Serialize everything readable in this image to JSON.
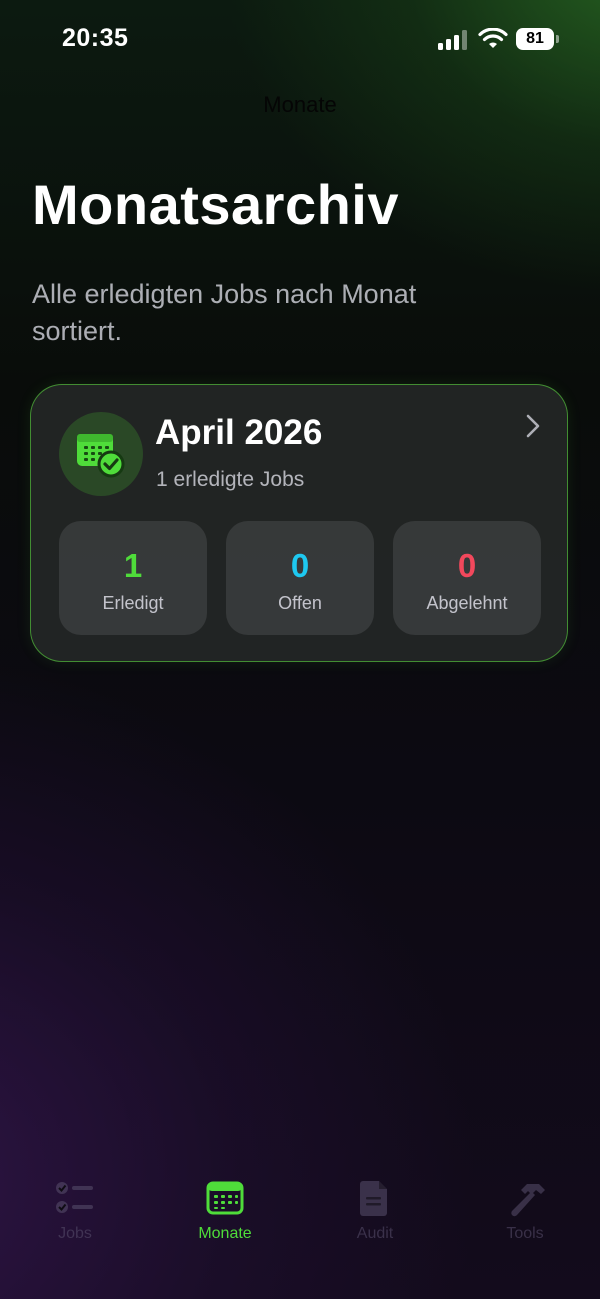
{
  "status_bar": {
    "time": "20:35",
    "battery": "81",
    "icons": [
      "cellular-signal-icon",
      "wifi-icon",
      "battery-icon"
    ]
  },
  "nav": {
    "title": "Monate"
  },
  "header": {
    "title": "Monatsarchiv",
    "subtitle": "Alle erledigten Jobs nach Monat sortiert."
  },
  "month_card": {
    "icon": "calendar-check-icon",
    "title": "April 2026",
    "subtitle": "1 erledigte Jobs",
    "chevron": "chevron-right-icon",
    "stats": [
      {
        "value": "1",
        "label": "Erledigt",
        "color": "#4fdc3a"
      },
      {
        "value": "0",
        "label": "Offen",
        "color": "#1ec8f0"
      },
      {
        "value": "0",
        "label": "Abgelehnt",
        "color": "#f2485c"
      }
    ]
  },
  "tab_bar": {
    "items": [
      {
        "label": "Jobs",
        "icon": "checklist-icon",
        "active": false
      },
      {
        "label": "Monate",
        "icon": "calendar-icon",
        "active": true
      },
      {
        "label": "Audit",
        "icon": "document-icon",
        "active": false
      },
      {
        "label": "Tools",
        "icon": "hammer-icon",
        "active": false
      }
    ]
  },
  "colors": {
    "accent": "#4fdc3a",
    "card_border": "#56c83c",
    "open": "#1ec8f0",
    "rejected": "#f2485c"
  }
}
